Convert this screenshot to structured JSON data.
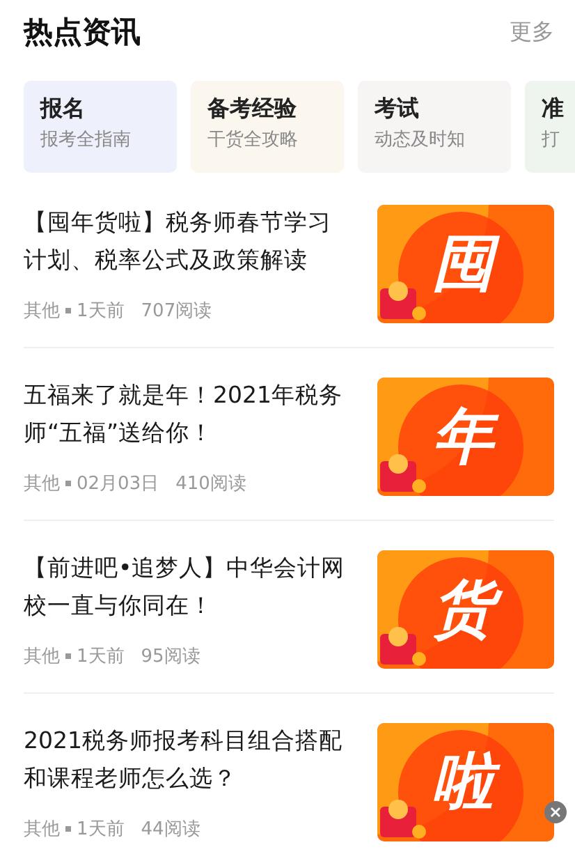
{
  "header": {
    "title": "热点资讯",
    "more": "更多"
  },
  "categories": [
    {
      "title": "报名",
      "subtitle": "报考全指南",
      "color": "#eef0fb"
    },
    {
      "title": "备考经验",
      "subtitle": "干货全攻略",
      "color": "#fbf7ef"
    },
    {
      "title": "考试",
      "subtitle": "动态及时知",
      "color": "#f7f4f4"
    },
    {
      "title": "准",
      "subtitle": "打",
      "color": "#eef5ee"
    }
  ],
  "articles": [
    {
      "title": "【囤年货啦】税务师春节学习计划、税率公式及政策解读",
      "source": "其他",
      "time": "1天前",
      "reads": "707阅读",
      "thumb_char": "囤"
    },
    {
      "title": "五福来了就是年！2021年税务师“五福”送给你！",
      "source": "其他",
      "time": "02月03日",
      "reads": "410阅读",
      "thumb_char": "年"
    },
    {
      "title": "【前进吧•追梦人】中华会计网校一直与你同在！",
      "source": "其他",
      "time": "1天前",
      "reads": "95阅读",
      "thumb_char": "货"
    },
    {
      "title": "2021税务师报考科目组合搭配和课程老师怎么选？",
      "source": "其他",
      "time": "1天前",
      "reads": "44阅读",
      "thumb_char": "啦"
    }
  ]
}
